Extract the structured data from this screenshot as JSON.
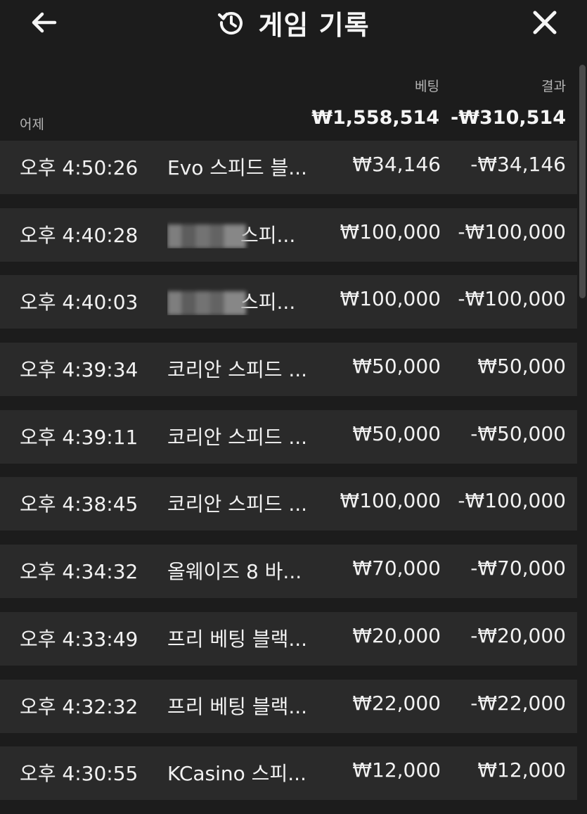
{
  "header": {
    "title": "게임 기록",
    "back_icon": "arrow-left-icon",
    "history_icon": "history-icon",
    "close_icon": "close-icon"
  },
  "columns": {
    "bet": "베팅",
    "result": "결과"
  },
  "summary": {
    "day": "어제",
    "bet_total": "₩1,558,514",
    "result_total": "-₩310,514"
  },
  "rows": [
    {
      "time": "오후 4:50:26",
      "game": "Evo 스피드 블...",
      "bet": "₩34,146",
      "result": "-₩34,146"
    },
    {
      "time": "오후 4:40:28",
      "game": "스피...",
      "game_obscured": true,
      "bet": "₩100,000",
      "result": "-₩100,000"
    },
    {
      "time": "오후 4:40:03",
      "game": "스피...",
      "game_obscured": true,
      "bet": "₩100,000",
      "result": "-₩100,000"
    },
    {
      "time": "오후 4:39:34",
      "game": "코리안 스피드 ...",
      "bet": "₩50,000",
      "result": "₩50,000"
    },
    {
      "time": "오후 4:39:11",
      "game": "코리안 스피드 ...",
      "bet": "₩50,000",
      "result": "-₩50,000"
    },
    {
      "time": "오후 4:38:45",
      "game": "코리안 스피드 ...",
      "bet": "₩100,000",
      "result": "-₩100,000"
    },
    {
      "time": "오후 4:34:32",
      "game": "올웨이즈 8 바...",
      "bet": "₩70,000",
      "result": "-₩70,000"
    },
    {
      "time": "오후 4:33:49",
      "game": "프리 베팅 블랙...",
      "bet": "₩20,000",
      "result": "-₩20,000"
    },
    {
      "time": "오후 4:32:32",
      "game": "프리 베팅 블랙...",
      "bet": "₩22,000",
      "result": "-₩22,000"
    },
    {
      "time": "오후 4:30:55",
      "game": "KCasino 스피...",
      "bet": "₩12,000",
      "result": "₩12,000"
    }
  ],
  "colors": {
    "background": "#1c1c1c",
    "row_background": "#2a2a2a",
    "text": "#f2f2f2",
    "muted_text": "#b5b5b5"
  }
}
